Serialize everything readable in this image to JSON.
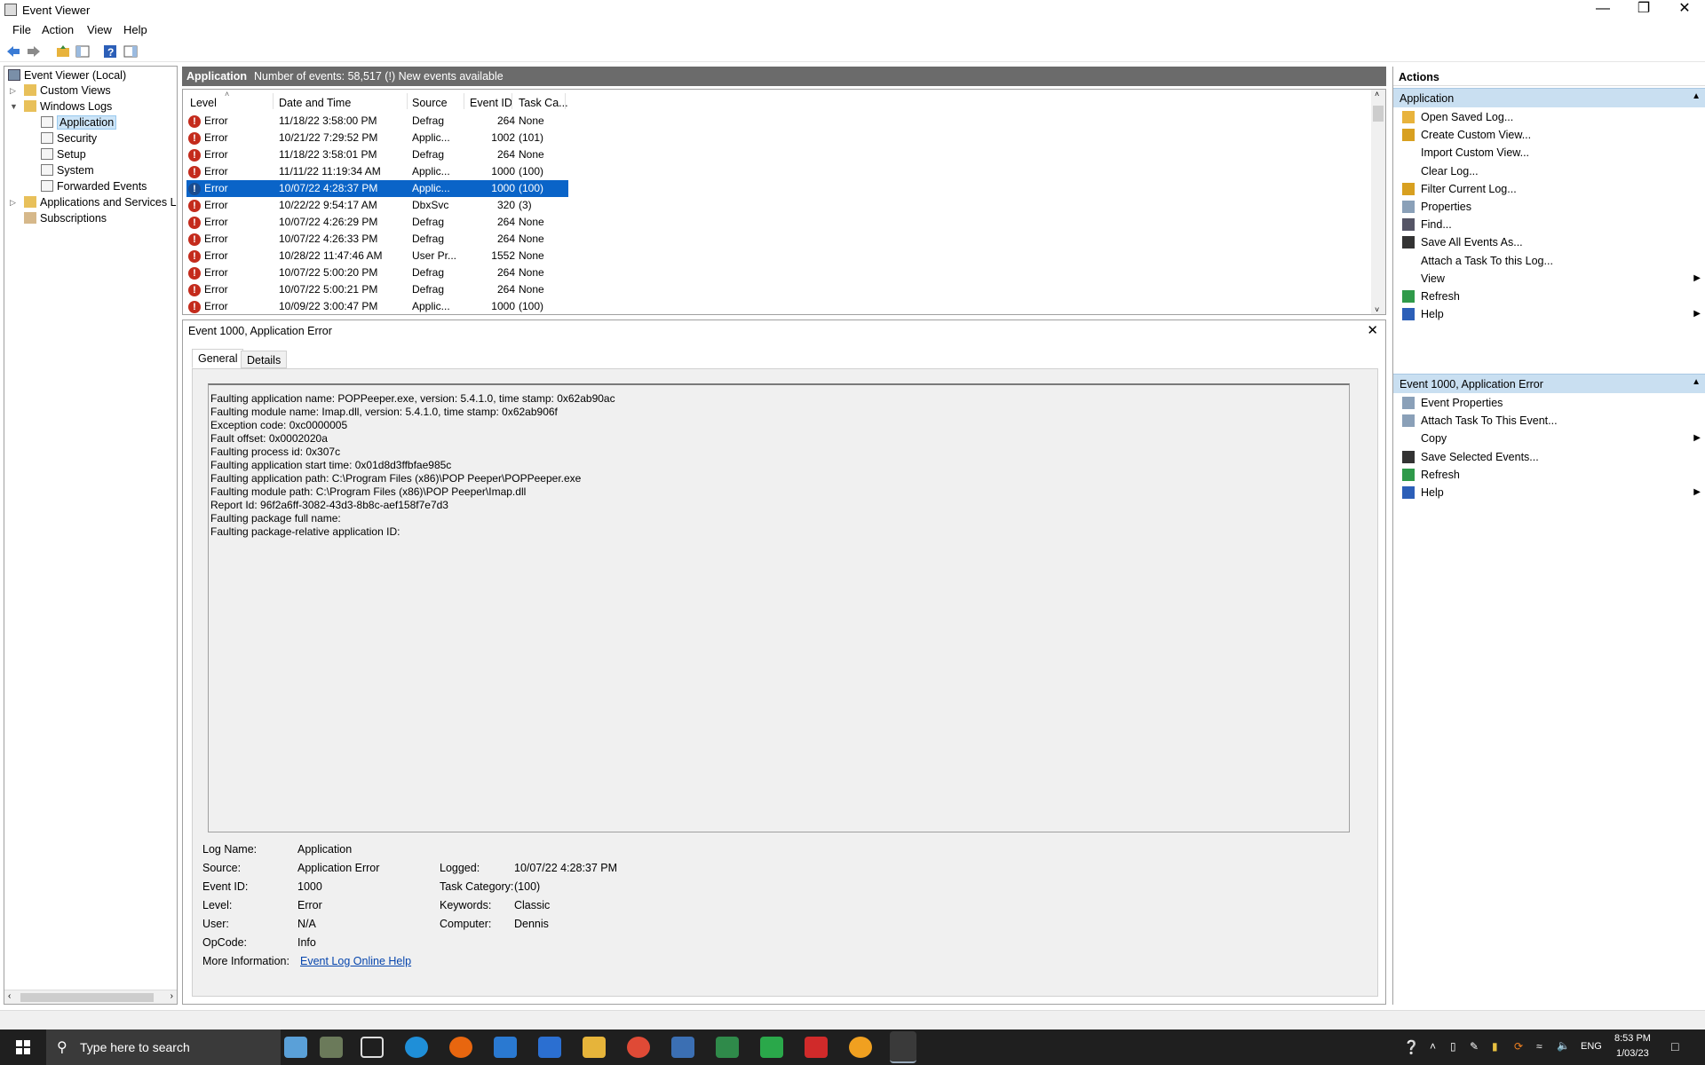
{
  "window": {
    "title": "Event Viewer"
  },
  "menu": {
    "file": "File",
    "action": "Action",
    "view": "View",
    "help": "Help"
  },
  "tree": {
    "root": "Event Viewer (Local)",
    "custom_views": "Custom Views",
    "windows_logs": "Windows Logs",
    "application": "Application",
    "security": "Security",
    "setup": "Setup",
    "system": "System",
    "forwarded": "Forwarded Events",
    "app_services": "Applications and Services Lo",
    "subscriptions": "Subscriptions"
  },
  "log_header": {
    "name": "Application",
    "info": "Number of events: 58,517 (!) New events available"
  },
  "columns": {
    "level": "Level",
    "datetime": "Date and Time",
    "source": "Source",
    "event_id": "Event ID",
    "task": "Task Ca..."
  },
  "events": [
    {
      "level": "Error",
      "datetime": "11/18/22 3:58:00 PM",
      "source": "Defrag",
      "id": "264",
      "task": "None"
    },
    {
      "level": "Error",
      "datetime": "10/21/22 7:29:52 PM",
      "source": "Applic...",
      "id": "1002",
      "task": "(101)"
    },
    {
      "level": "Error",
      "datetime": "11/18/22 3:58:01 PM",
      "source": "Defrag",
      "id": "264",
      "task": "None"
    },
    {
      "level": "Error",
      "datetime": "11/11/22 11:19:34 AM",
      "source": "Applic...",
      "id": "1000",
      "task": "(100)"
    },
    {
      "level": "Error",
      "datetime": "10/07/22 4:28:37 PM",
      "source": "Applic...",
      "id": "1000",
      "task": "(100)"
    },
    {
      "level": "Error",
      "datetime": "10/22/22 9:54:17 AM",
      "source": "DbxSvc",
      "id": "320",
      "task": "(3)"
    },
    {
      "level": "Error",
      "datetime": "10/07/22 4:26:29 PM",
      "source": "Defrag",
      "id": "264",
      "task": "None"
    },
    {
      "level": "Error",
      "datetime": "10/07/22 4:26:33 PM",
      "source": "Defrag",
      "id": "264",
      "task": "None"
    },
    {
      "level": "Error",
      "datetime": "10/28/22 11:47:46 AM",
      "source": "User Pr...",
      "id": "1552",
      "task": "None"
    },
    {
      "level": "Error",
      "datetime": "10/07/22 5:00:20 PM",
      "source": "Defrag",
      "id": "264",
      "task": "None"
    },
    {
      "level": "Error",
      "datetime": "10/07/22 5:00:21 PM",
      "source": "Defrag",
      "id": "264",
      "task": "None"
    },
    {
      "level": "Error",
      "datetime": "10/09/22 3:00:47 PM",
      "source": "Applic...",
      "id": "1000",
      "task": "(100)"
    }
  ],
  "selected_row_index": 4,
  "detail": {
    "title": "Event 1000, Application Error",
    "tab_general": "General",
    "tab_details": "Details",
    "description": [
      "Faulting application name: POPPeeper.exe, version: 5.4.1.0, time stamp: 0x62ab90ac",
      "Faulting module name: Imap.dll, version: 5.4.1.0, time stamp: 0x62ab906f",
      "Exception code: 0xc0000005",
      "Fault offset: 0x0002020a",
      "Faulting process id: 0x307c",
      "Faulting application start time: 0x01d8d3ffbfae985c",
      "Faulting application path: C:\\Program Files (x86)\\POP Peeper\\POPPeeper.exe",
      "Faulting module path: C:\\Program Files (x86)\\POP Peeper\\Imap.dll",
      "Report Id: 96f2a6ff-3082-43d3-8b8c-aef158f7e7d3",
      "Faulting package full name: ",
      "Faulting package-relative application ID: "
    ],
    "props": {
      "log_name_label": "Log Name:",
      "log_name": "Application",
      "source_label": "Source:",
      "source": "Application Error",
      "logged_label": "Logged:",
      "logged": "10/07/22 4:28:37 PM",
      "event_id_label": "Event ID:",
      "event_id": "1000",
      "task_label": "Task Category:",
      "task": "(100)",
      "level_label": "Level:",
      "level": "Error",
      "keywords_label": "Keywords:",
      "keywords": "Classic",
      "user_label": "User:",
      "user": "N/A",
      "computer_label": "Computer:",
      "computer": "Dennis",
      "opcode_label": "OpCode:",
      "opcode": "Info",
      "more_label": "More Information:",
      "more_link": "Event Log Online Help"
    }
  },
  "actions": {
    "header": "Actions",
    "group1": "Application",
    "group1_items": [
      "Open Saved Log...",
      "Create Custom View...",
      "Import Custom View...",
      "Clear Log...",
      "Filter Current Log...",
      "Properties",
      "Find...",
      "Save All Events As...",
      "Attach a Task To this Log...",
      "View",
      "Refresh",
      "Help"
    ],
    "group2": "Event 1000, Application Error",
    "group2_items": [
      "Event Properties",
      "Attach Task To This Event...",
      "Copy",
      "Save Selected Events...",
      "Refresh",
      "Help"
    ]
  },
  "taskbar": {
    "search_placeholder": "Type here to search",
    "lang": "ENG",
    "time": "8:53 PM",
    "date": "1/03/23"
  }
}
